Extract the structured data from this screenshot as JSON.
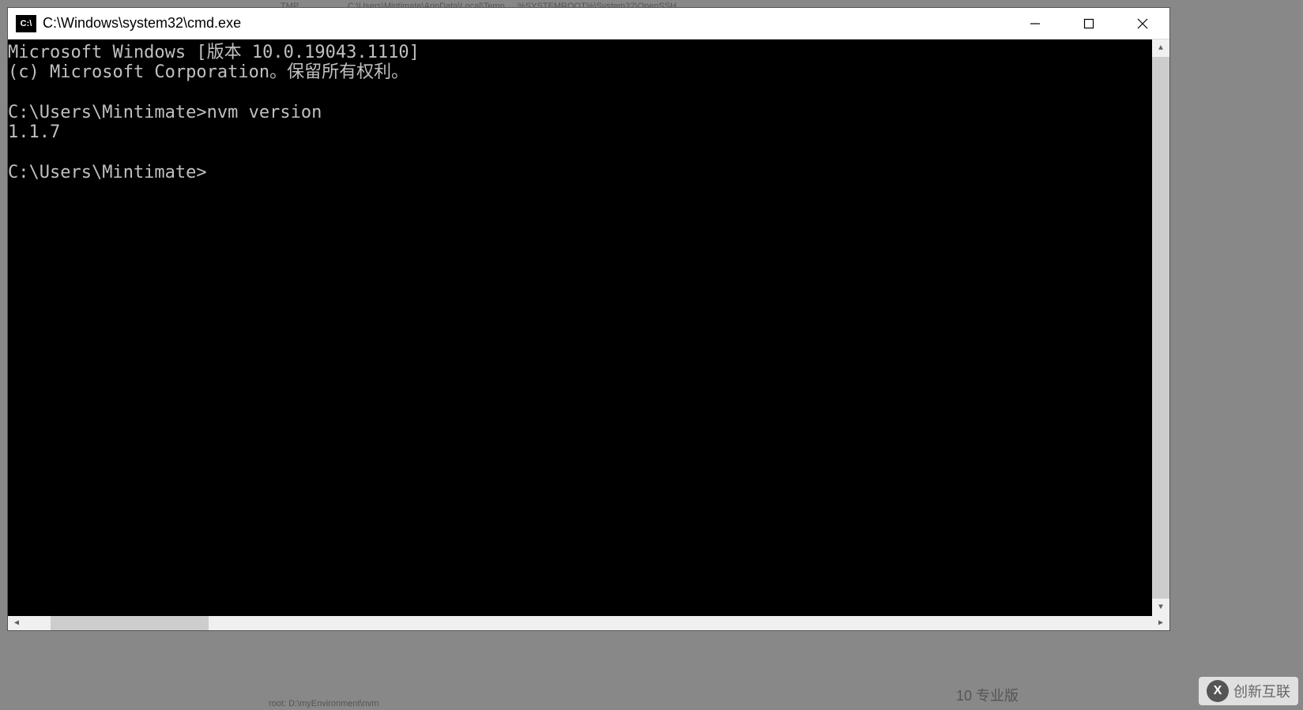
{
  "window": {
    "title": "C:\\Windows\\system32\\cmd.exe",
    "icon_label": "C:\\"
  },
  "terminal": {
    "lines": [
      "Microsoft Windows [版本 10.0.19043.1110]",
      "(c) Microsoft Corporation。保留所有权利。",
      "",
      "C:\\Users\\Mintimate>nvm version",
      "1.1.7",
      "",
      "C:\\Users\\Mintimate>"
    ]
  },
  "watermark": {
    "text": "创新互联",
    "icon": "X"
  },
  "background_fragments": {
    "tmp": "TMP",
    "path1": "C:\\Users\\Mintimate\\AppData\\Local\\Temp",
    "path2": "%SYSTEMROOT%\\System32\\OpenSSH",
    "bottom": "root: D:\\myEnvironment\\nvm",
    "os": "10 专业版"
  },
  "controls": {
    "minimize": "minimize",
    "maximize": "maximize",
    "close": "close"
  }
}
